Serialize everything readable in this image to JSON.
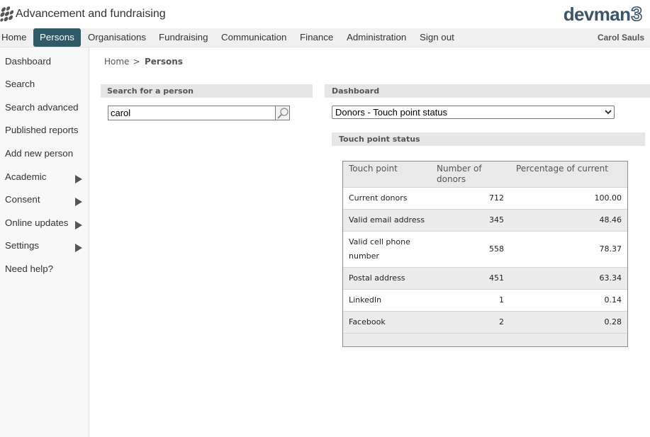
{
  "app": {
    "title": "Advancement and fundraising",
    "brand": {
      "name": "devman",
      "version": "3"
    }
  },
  "nav": {
    "items": [
      {
        "label": "Home"
      },
      {
        "label": "Persons",
        "active": true
      },
      {
        "label": "Organisations"
      },
      {
        "label": "Fundraising"
      },
      {
        "label": "Communication"
      },
      {
        "label": "Finance"
      },
      {
        "label": "Administration"
      },
      {
        "label": "Sign out"
      }
    ],
    "user_name": "Carol Sauls"
  },
  "sidebar": {
    "items": [
      {
        "label": "Dashboard"
      },
      {
        "label": "Search"
      },
      {
        "label": "Search advanced"
      },
      {
        "label": "Published reports"
      },
      {
        "label": "Add new person"
      },
      {
        "label": "Academic",
        "has_submenu": true
      },
      {
        "label": "Consent",
        "has_submenu": true
      },
      {
        "label": "Online updates",
        "has_submenu": true
      },
      {
        "label": "Settings",
        "has_submenu": true
      },
      {
        "label": "Need help?"
      }
    ]
  },
  "breadcrumb": {
    "items": [
      "Home",
      "Persons"
    ],
    "separator": ">"
  },
  "search_panel": {
    "title": "Search for a person",
    "query": "carol"
  },
  "dashboard_panel": {
    "title": "Dashboard",
    "selected_dashboard": "Donors - Touch point status",
    "section_title": "Touch point status",
    "table": {
      "columns": [
        "Touch point",
        "Number of donors",
        "Percentage of current"
      ],
      "rows": [
        {
          "touch_point": "Current donors",
          "donors": "712",
          "percentage": "100.00"
        },
        {
          "touch_point": "Valid email address",
          "donors": "345",
          "percentage": "48.46"
        },
        {
          "touch_point": "Valid cell phone number",
          "donors": "558",
          "percentage": "78.37"
        },
        {
          "touch_point": "Postal address",
          "donors": "451",
          "percentage": "63.34"
        },
        {
          "touch_point": "LinkedIn",
          "donors": "1",
          "percentage": "0.14"
        },
        {
          "touch_point": "Facebook",
          "donors": "2",
          "percentage": "0.28"
        }
      ]
    }
  },
  "icons": {
    "app_logo": "leaf-grid-logo-icon",
    "search_button": "search-icon",
    "select_dropdown": "chevron-down-icon",
    "submenu_indicator": "caret-right-icon"
  },
  "colors": {
    "nav_active_bg": "#2f5b69",
    "brand": "#3b566a",
    "panel_header_bg": "#e6e6e6",
    "nav_bg": "#f0f0f0",
    "sidebar_bg": "#f8f8f8",
    "table_alt_row_bg": "#ececec"
  }
}
